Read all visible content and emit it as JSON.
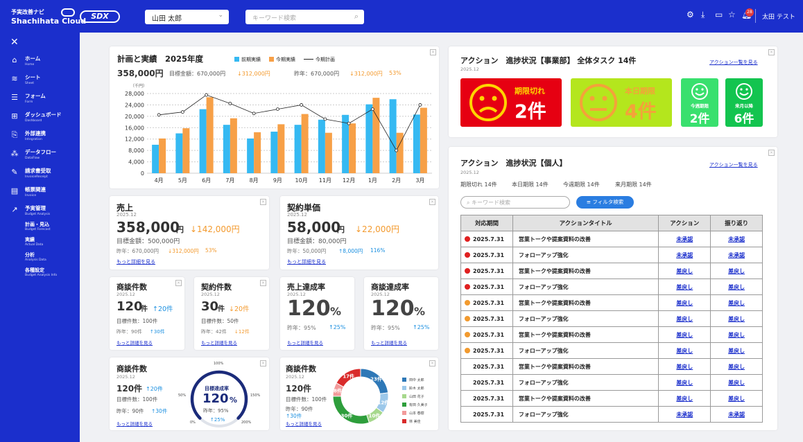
{
  "header": {
    "logo_line1": "予実改善ナビ",
    "logo_line2": "Shachihata Cloud",
    "logo_badge": "SDX",
    "user_select": "山田 太郎",
    "search_placeholder": "キーワード検索",
    "notif_count": "28",
    "user_name": "太田 テスト"
  },
  "sidebar": {
    "items": [
      {
        "label": "ホーム",
        "sub": "Home"
      },
      {
        "label": "シート",
        "sub": "Sheet"
      },
      {
        "label": "フォーム",
        "sub": "Form"
      },
      {
        "label": "ダッシュボード",
        "sub": "Dashboard"
      },
      {
        "label": "外部連携",
        "sub": "Integration"
      },
      {
        "label": "データフロー",
        "sub": "DataFlow"
      },
      {
        "label": "請求書受取",
        "sub": "InvoiceReceipt"
      },
      {
        "label": "帳票関連",
        "sub": "Invoice"
      },
      {
        "label": "予実管理",
        "sub": "Budget Analysis"
      }
    ],
    "subitems": [
      {
        "label": "計画・見込",
        "sub": "Budget Forecast"
      },
      {
        "label": "実績",
        "sub": "Actual Data"
      },
      {
        "label": "分析",
        "sub": "Analysis Data"
      },
      {
        "label": "各種設定",
        "sub": "Budget Analysis Info"
      }
    ]
  },
  "plan": {
    "title": "計画と実績　2025年度",
    "value": "358,000円",
    "target": "目標金額：670,000円",
    "diff": "↓312,000円",
    "prev": "昨年：670,000円",
    "prev_diff": "↓312,000円",
    "prev_pct": "53%",
    "unit": "（千円）"
  },
  "chart_data": {
    "type": "bar",
    "categories": [
      "4月",
      "5月",
      "6月",
      "7月",
      "8月",
      "9月",
      "10月",
      "11月",
      "12月",
      "1月",
      "2月",
      "3月"
    ],
    "series": [
      {
        "name": "前期実績",
        "color": "#35b9f2",
        "values": [
          10000,
          14000,
          22500,
          17000,
          12200,
          14600,
          17000,
          18800,
          20500,
          24200,
          26000,
          20600
        ]
      },
      {
        "name": "今期実績",
        "color": "#f7a047",
        "values": [
          12200,
          15800,
          26700,
          19300,
          14400,
          17200,
          20800,
          14200,
          17500,
          26500,
          14200,
          23000
        ]
      },
      {
        "name": "今期計画",
        "color": "#222",
        "values": [
          20500,
          21500,
          27500,
          24500,
          21000,
          22500,
          24000,
          19000,
          17500,
          22500,
          8000,
          24000
        ]
      }
    ],
    "ylim": [
      0,
      28000
    ],
    "yticks": [
      "0",
      "4,000",
      "8,000",
      "12,000",
      "16,000",
      "20,000",
      "24,000",
      "28,000"
    ]
  },
  "sales": {
    "title": "売上",
    "date": "2025.12",
    "value": "358,000",
    "unit": "円",
    "diff": "↓142,000円",
    "target": "目標金額：500,000円",
    "prev": "昨年：670,000円",
    "prev_diff": "↓312,000円",
    "prev_pct": "53%",
    "link": "もっと詳細を見る"
  },
  "contract": {
    "title": "契約単価",
    "date": "2025.12",
    "value": "58,000",
    "unit": "円",
    "diff": "↓22,000円",
    "target": "目標金額：80,000円",
    "prev": "昨年：50,000円",
    "prev_diff": "↑8,000円",
    "prev_pct": "116%",
    "link": "もっと詳細を見る"
  },
  "deals": {
    "title": "商談件数",
    "date": "2025.12",
    "value": "120",
    "unit": "件",
    "diff": "↑20件",
    "target": "目標件数：100件",
    "prev": "昨年：90件",
    "prev_diff": "↑30件",
    "link": "もっと詳細を見る"
  },
  "contracts": {
    "title": "契約件数",
    "date": "2025.12",
    "value": "30",
    "unit": "件",
    "diff": "↓20件",
    "target": "目標件数：50件",
    "prev": "昨年：42件",
    "prev_diff": "↓12件",
    "link": "もっと詳細を見る"
  },
  "sales_rate": {
    "title": "売上達成率",
    "date": "2025.12",
    "value": "120",
    "unit": "%",
    "prev": "昨年：95%",
    "prev_diff": "↑25%",
    "link": "もっと詳細を見る"
  },
  "deal_rate": {
    "title": "商談達成率",
    "date": "2025.12",
    "value": "120",
    "unit": "%",
    "prev": "昨年：95%",
    "prev_diff": "↑25%",
    "link": "もっと詳細を見る"
  },
  "gauge": {
    "title": "商談件数",
    "date": "2025.12",
    "value": "120件",
    "diff": "↑20件",
    "target": "目標件数：100件",
    "prev": "昨年：90件",
    "prev_diff": "↑30件",
    "link": "もっと詳細を見る",
    "g_title": "目標達成率",
    "g_value": "120",
    "g_unit": "%",
    "g_prev": "昨年：95%",
    "g_diff": "↑25%",
    "t0": "0%",
    "t50": "50%",
    "t100": "100%",
    "t150": "150%",
    "t200": "200%"
  },
  "donut": {
    "title": "商談件数",
    "date": "2025.12",
    "value": "120件",
    "target": "目標件数：100件",
    "prev": "昨年：90件",
    "prev_diff": "↑30件",
    "link": "もっと詳細を見る",
    "slices": [
      {
        "name": "田中 太郎",
        "label": "23件",
        "value": 23,
        "color": "#2e78b7"
      },
      {
        "name": "鈴木 太郎",
        "label": "12件",
        "value": 12,
        "color": "#9cc8ea"
      },
      {
        "name": "山田 花子",
        "label": "10件",
        "value": 10,
        "color": "#a6d88c"
      },
      {
        "name": "有田 久美子",
        "label": "30件",
        "value": 30,
        "color": "#2e9e3c"
      },
      {
        "name": "山本 春樹",
        "label": "8件",
        "value": 8,
        "color": "#f29a9a"
      },
      {
        "name": "林 美佳",
        "label": "17件",
        "value": 17,
        "color": "#d92b2b"
      }
    ]
  },
  "actions_dept": {
    "title": "アクション　進捗状況【事業部】 全体タスク 14件",
    "date": "2025.12",
    "link": "アクション一覧を見る",
    "overdue_label": "期限切れ",
    "overdue_count": "2件",
    "today_label": "本日期限",
    "today_count": "4件",
    "week_label": "今週期限",
    "week_count": "2件",
    "next_label": "来月以降",
    "next_count": "6件"
  },
  "actions_personal": {
    "title": "アクション　進捗状況【個人】",
    "date": "2025.12",
    "link": "アクション一覧を見る",
    "s1": "期限切れ 14件",
    "s2": "本日期限 14件",
    "s3": "今週期限 14件",
    "s4": "来月期限 14件",
    "search_placeholder": "キーワード検索",
    "filter_label": "フィルタ検索",
    "headers": [
      "対応期間",
      "アクションタイトル",
      "アクション",
      "振り返り"
    ],
    "rows": [
      {
        "status": "red",
        "date": "2025.7.31",
        "title": "営業トークや提案資料の改善",
        "action": "未承認",
        "review": "未承認"
      },
      {
        "status": "red",
        "date": "2025.7.31",
        "title": "フォローアップ強化",
        "action": "未承認",
        "review": "未承認"
      },
      {
        "status": "red",
        "date": "2025.7.31",
        "title": "営業トークや提案資料の改善",
        "action": "差戻し",
        "review": "差戻し"
      },
      {
        "status": "red",
        "date": "2025.7.31",
        "title": "フォローアップ強化",
        "action": "差戻し",
        "review": "差戻し"
      },
      {
        "status": "orange",
        "date": "2025.7.31",
        "title": "営業トークや提案資料の改善",
        "action": "差戻し",
        "review": "差戻し"
      },
      {
        "status": "orange",
        "date": "2025.7.31",
        "title": "フォローアップ強化",
        "action": "差戻し",
        "review": "差戻し"
      },
      {
        "status": "orange",
        "date": "2025.7.31",
        "title": "営業トークや提案資料の改善",
        "action": "差戻し",
        "review": "差戻し"
      },
      {
        "status": "orange",
        "date": "2025.7.31",
        "title": "フォローアップ強化",
        "action": "差戻し",
        "review": "差戻し"
      },
      {
        "status": "none",
        "date": "2025.7.31",
        "title": "営業トークや提案資料の改善",
        "action": "差戻し",
        "review": "差戻し"
      },
      {
        "status": "none",
        "date": "2025.7.31",
        "title": "フォローアップ強化",
        "action": "差戻し",
        "review": "差戻し"
      },
      {
        "status": "none",
        "date": "2025.7.31",
        "title": "営業トークや提案資料の改善",
        "action": "差戻し",
        "review": "差戻し"
      },
      {
        "status": "none",
        "date": "2025.7.31",
        "title": "フォローアップ強化",
        "action": "未承認",
        "review": "未承認"
      }
    ]
  }
}
